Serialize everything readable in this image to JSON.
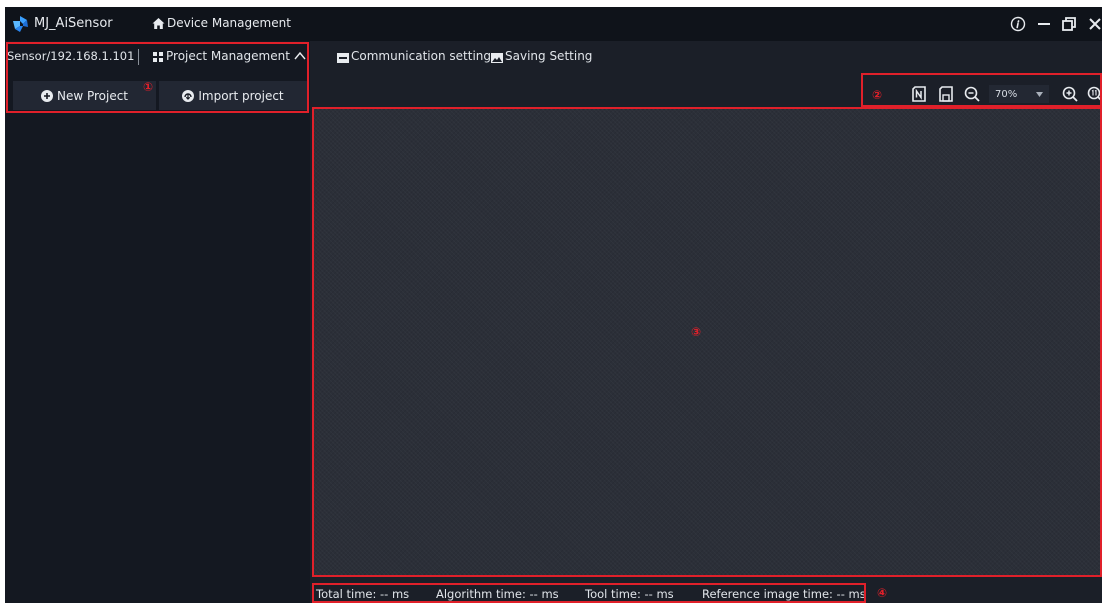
{
  "titlebar": {
    "app_title": "MJ_AiSensor",
    "device_management": "Device Management"
  },
  "sidebar": {
    "sensor": "Sensor/192.168.1.101",
    "project_management": "Project Management",
    "new_project": "New Project",
    "import_project": "Import project"
  },
  "topbar": {
    "communication_settings": "Communication settings",
    "saving_setting": "Saving Setting"
  },
  "toolbar": {
    "zoom_value": "70%",
    "zoom_options": [
      "70%"
    ]
  },
  "status": {
    "total_time": "Total time: -- ms",
    "algorithm_time": "Algorithm time: -- ms",
    "tool_time": "Tool time: -- ms",
    "reference_image_time": "Reference image time: -- ms"
  },
  "annotations": {
    "one": "①",
    "two": "②",
    "three": "③",
    "four": "④"
  },
  "colors": {
    "annotation_red": "#e0202a",
    "titlebar_bg": "#0f131a",
    "panel_bg": "#1b1f28",
    "canvas_bg": "#2b2f38"
  }
}
